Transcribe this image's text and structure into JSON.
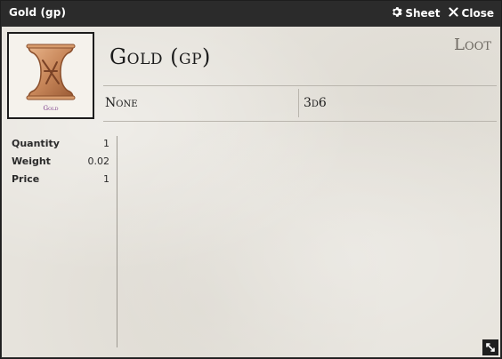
{
  "window": {
    "title": "Gold (gp)",
    "sheet_label": "Sheet",
    "close_label": "Close"
  },
  "item": {
    "name": "Gold (gp)",
    "type": "Loot",
    "image_caption": "Gold",
    "rarity": "None",
    "damage": "3d6"
  },
  "properties": [
    {
      "label": "Quantity",
      "value": "1"
    },
    {
      "label": "Weight",
      "value": "0.02"
    },
    {
      "label": "Price",
      "value": "1"
    }
  ],
  "icons": {
    "sheet": "gear-icon",
    "close": "close-icon",
    "resize": "resize-icon"
  },
  "colors": {
    "titlebar": "#2b2b2b",
    "parchment": "#e6e3dc",
    "item_image": "#c8875a"
  }
}
